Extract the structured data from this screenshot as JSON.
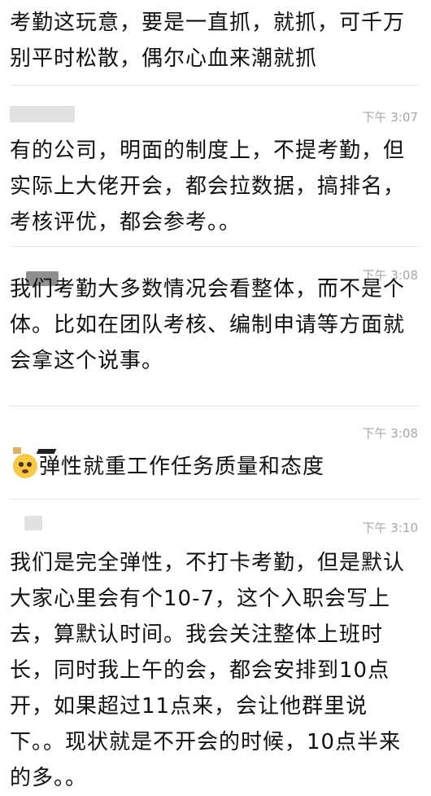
{
  "messages": [
    {
      "text": "考勤这玩意，要是一直抓，就抓，可千万别平时松散，偶尔心血来潮就抓"
    },
    {
      "time": "下午 3:07",
      "text": "有的公司，明面的制度上，不提考勤，但实际上大佬开会，都会拉数据，搞排名，考核评优，都会参考。。"
    },
    {
      "time": "下午 3:08",
      "text": "我们考勤大多数情况会看整体，而不是个体。比如在团队考核、编制申请等方面就会拿这个说事。"
    },
    {
      "time": "下午 3:08",
      "text": "弹性就重工作任务质量和态度"
    },
    {
      "time": "下午 3:10",
      "text": "我们是完全弹性，不打卡考勤，但是默认大家心里会有个10-7，这个入职会写上去，算默认时间。我会关注整体上班时长，同时我上午的会，都会安排到10点开，如果超过11点来，会让他群里说下。。现状就是不开会的时候，10点半来的多。。"
    }
  ]
}
